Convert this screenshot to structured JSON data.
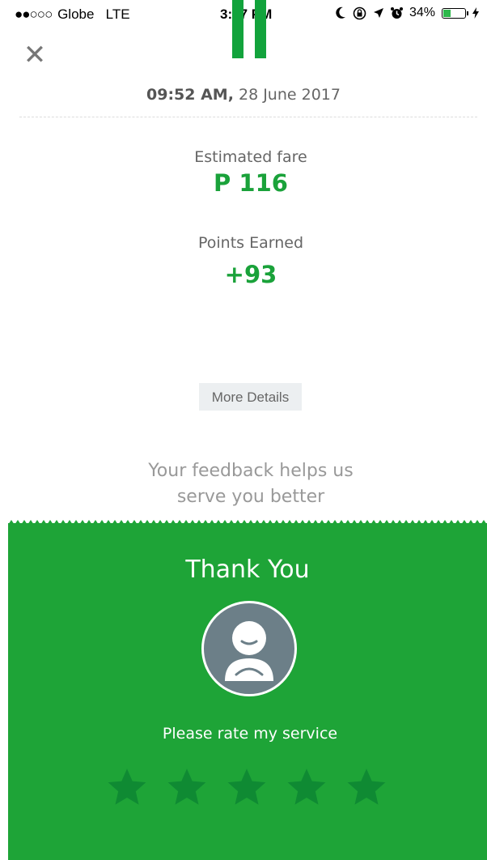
{
  "status_bar": {
    "signal": "●●○○○",
    "carrier": "Globe",
    "network": "LTE",
    "time": "3:47 PM",
    "icons": [
      "moon-icon",
      "rotation-lock-icon",
      "location-arrow-icon",
      "alarm-icon"
    ],
    "battery_percent_text": "34%",
    "battery_level": 0.34,
    "charging_icon": "bolt-icon"
  },
  "trip": {
    "time": "09:52 AM,",
    "date": "28 June 2017"
  },
  "fare": {
    "label": "Estimated fare",
    "value": "P 116"
  },
  "points": {
    "label": "Points Earned",
    "value": "+93"
  },
  "more_details_label": "More Details",
  "feedback_line1": "Your feedback helps us",
  "feedback_line2": "serve you better",
  "rating": {
    "title": "Thank You",
    "prompt": "Please rate my service",
    "star_count": 5,
    "selected": 0
  },
  "colors": {
    "accent": "#1aa23a",
    "panel": "#1ea437",
    "star": "#0f8a33",
    "avatar": "#6c7f88"
  }
}
